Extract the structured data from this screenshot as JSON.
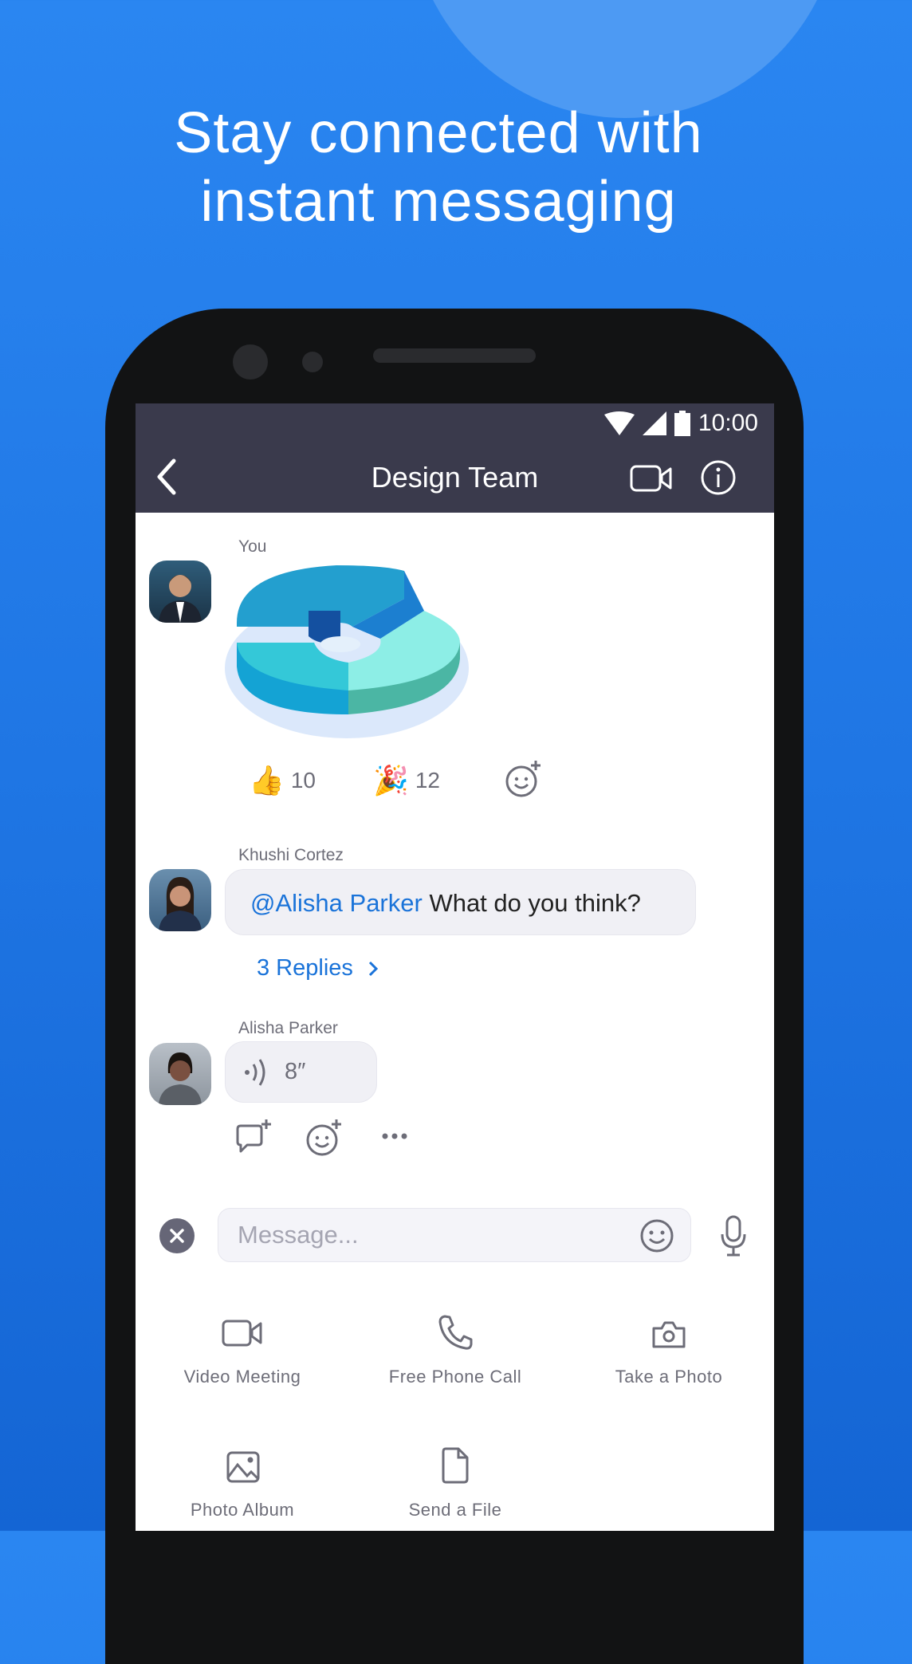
{
  "headline": {
    "line1": "Stay connected with",
    "line2": "instant messaging"
  },
  "status_bar": {
    "time": "10:00"
  },
  "header": {
    "title": "Design Team"
  },
  "messages": [
    {
      "sender": "You",
      "reactions": [
        {
          "emoji": "👍",
          "count": "10"
        },
        {
          "emoji": "🎉",
          "count": "12"
        }
      ]
    },
    {
      "sender": "Khushi Cortez",
      "mention": "@Alisha Parker",
      "text": " What do you think?",
      "replies": "3 Replies"
    },
    {
      "sender": "Alisha Parker",
      "voice_duration": "8″"
    }
  ],
  "composer": {
    "placeholder": "Message..."
  },
  "actions": [
    {
      "label": "Video Meeting",
      "icon": "video-camera-icon"
    },
    {
      "label": "Free Phone Call",
      "icon": "phone-icon"
    },
    {
      "label": "Take a Photo",
      "icon": "camera-icon"
    },
    {
      "label": "Photo Album",
      "icon": "image-icon"
    },
    {
      "label": "Send a File",
      "icon": "file-icon"
    }
  ],
  "colors": {
    "background": "#1f76e4",
    "header": "#3a3a4c",
    "mention": "#1a73d9"
  }
}
